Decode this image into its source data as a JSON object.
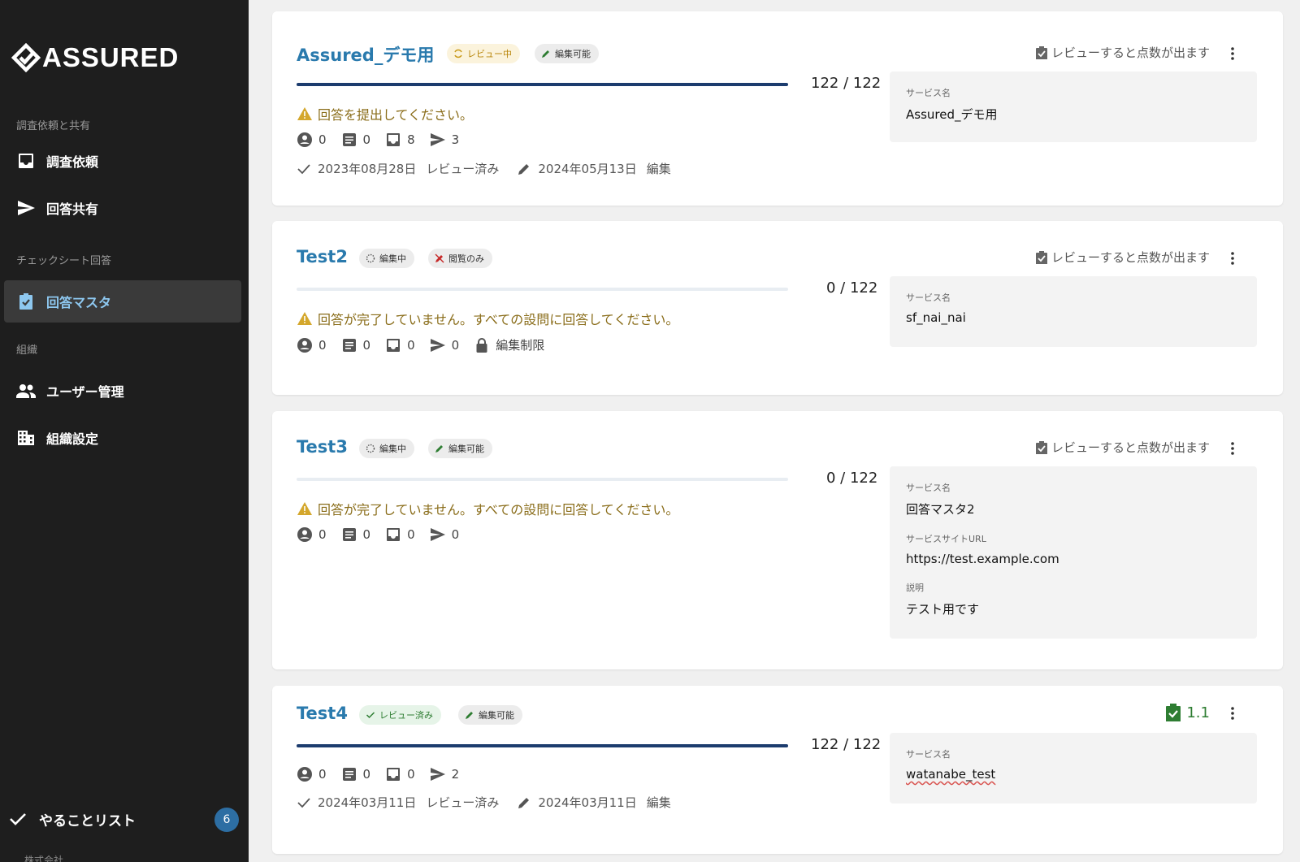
{
  "app": {
    "logo_text": "ASSURED"
  },
  "sidebar": {
    "section1": "調査依頼と共有",
    "item_request": "調査依頼",
    "item_share": "回答共有",
    "section2": "チェックシート回答",
    "item_master": "回答マスタ",
    "section3": "組織",
    "item_users": "ユーザー管理",
    "item_org": "組織設定",
    "todo_label": "やることリスト",
    "todo_count": "6",
    "footer": "株式会社"
  },
  "cards": [
    {
      "title": "Assured_デモ用",
      "status_chip": "レビュー中",
      "perm_chip": "編集可能",
      "progress": 1.0,
      "count": "122 / 122",
      "warning": "回答を提出してください。",
      "stats": [
        "0",
        "0",
        "8",
        "3"
      ],
      "meta_review_date": "2023年08月28日",
      "meta_review_label": "レビュー済み",
      "meta_edit_date": "2024年05月13日",
      "meta_edit_label": "編集",
      "score_hint": "レビューすると点数が出ます",
      "info_label": "サービス名",
      "info_value": "Assured_デモ用"
    },
    {
      "title": "Test2",
      "status_chip": "編集中",
      "perm_chip": "閲覧のみ",
      "progress": 0,
      "count": "0 / 122",
      "warning": "回答が完了していません。すべての設問に回答してください。",
      "stats": [
        "0",
        "0",
        "0",
        "0"
      ],
      "lock_label": "編集制限",
      "score_hint": "レビューすると点数が出ます",
      "info_label": "サービス名",
      "info_value": "sf_nai_nai"
    },
    {
      "title": "Test3",
      "status_chip": "編集中",
      "perm_chip": "編集可能",
      "progress": 0,
      "count": "0 / 122",
      "warning": "回答が完了していません。すべての設問に回答してください。",
      "stats": [
        "0",
        "0",
        "0",
        "0"
      ],
      "score_hint": "レビューすると点数が出ます",
      "info_label": "サービス名",
      "info_value": "回答マスタ2",
      "info_label2": "サービスサイトURL",
      "info_value2": "https://test.example.com",
      "info_label3": "説明",
      "info_value3": "テスト用です"
    },
    {
      "title": "Test4",
      "status_chip": "レビュー済み",
      "perm_chip": "編集可能",
      "progress": 1.0,
      "count": "122 / 122",
      "stats": [
        "0",
        "0",
        "0",
        "2"
      ],
      "meta_review_date": "2024年03月11日",
      "meta_review_label": "レビュー済み",
      "meta_edit_date": "2024年03月11日",
      "meta_edit_label": "編集",
      "score": "1.1",
      "info_label": "サービス名",
      "info_value": "watanabe_test"
    }
  ],
  "colors": {
    "sidebar_bg": "#1e1e1e",
    "accent": "#2a7aad",
    "progress": "#1c3c6e",
    "warning": "#8a6d1a",
    "score": "#2e7d32"
  }
}
